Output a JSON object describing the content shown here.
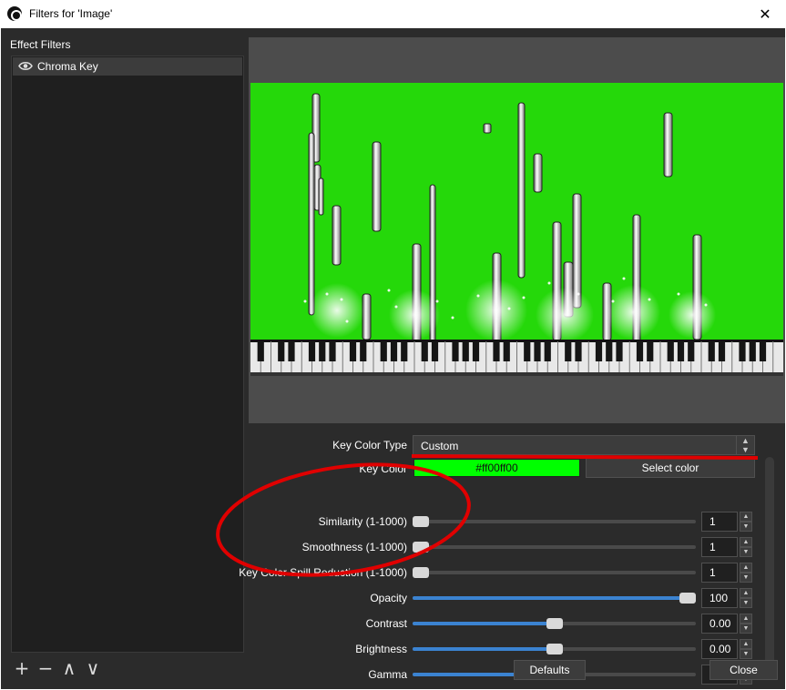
{
  "window": {
    "title": "Filters for 'Image'",
    "close_glyph": "✕"
  },
  "filters": {
    "section_label": "Effect Filters",
    "items": [
      {
        "label": "Chroma Key",
        "visible": true,
        "icon": "eye-icon"
      }
    ]
  },
  "list_tools": {
    "add": "+",
    "remove": "−",
    "up": "∧",
    "down": "∨"
  },
  "properties": {
    "key_color_type": {
      "label": "Key Color Type",
      "value": "Custom"
    },
    "key_color": {
      "label": "Key Color",
      "value": "#ff00ff00",
      "button": "Select color",
      "swatch": "#00ff00"
    },
    "similarity": {
      "label": "Similarity (1-1000)",
      "value": "1",
      "min": 1,
      "max": 1000
    },
    "smoothness": {
      "label": "Smoothness (1-1000)",
      "value": "1",
      "min": 1,
      "max": 1000
    },
    "spill": {
      "label": "Key Color Spill Reduction (1-1000)",
      "value": "1",
      "min": 1,
      "max": 1000
    },
    "opacity": {
      "label": "Opacity",
      "value": "100",
      "min": 0,
      "max": 100
    },
    "contrast": {
      "label": "Contrast",
      "value": "0.00",
      "min": -1,
      "max": 1
    },
    "brightness": {
      "label": "Brightness",
      "value": "0.00",
      "min": -1,
      "max": 1
    },
    "gamma": {
      "label": "Gamma",
      "value": "0.00",
      "min": -1,
      "max": 1
    }
  },
  "buttons": {
    "defaults": "Defaults",
    "close": "Close"
  },
  "colors": {
    "green_screen": "#25d80a",
    "accent_blue": "#3b83d1",
    "annotation_red": "#e00000"
  }
}
